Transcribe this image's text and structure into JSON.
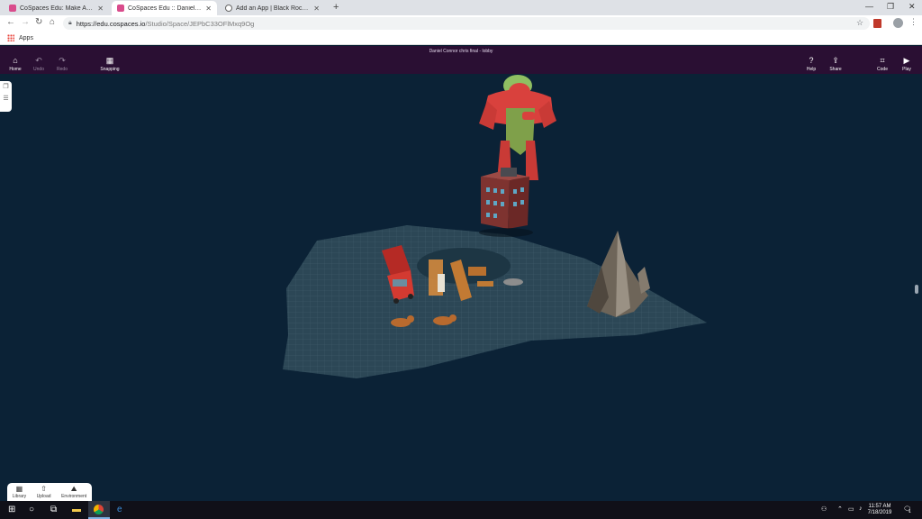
{
  "browser": {
    "tabs": [
      {
        "title": "CoSpaces Edu: Make AR & VR in",
        "favicon": "cospaces-icon",
        "active": false
      },
      {
        "title": "CoSpaces Edu :: Daniel Connor c",
        "favicon": "cospaces-icon",
        "active": true
      },
      {
        "title": "Add an App | Black Rocket Arcad",
        "favicon": "globe-icon",
        "active": false
      }
    ],
    "new_tab": "+",
    "url_host": "https://edu.cospaces.io",
    "url_path": "/Studio/Space/JEPbC33OFlMxq9Og",
    "bookmarks_apps": "Apps"
  },
  "toolbar": {
    "scene_title": "Daniel Connor chris final - lobby",
    "home": "Home",
    "undo": "Undo",
    "redo": "Redo",
    "snapping": "Snapping",
    "help": "Help",
    "share": "Share",
    "code": "Code",
    "play": "Play"
  },
  "library_panel": {
    "library": "Library",
    "upload": "Upload",
    "environment": "Environment"
  },
  "taskbar": {
    "time": "11:57 AM",
    "date": "7/18/2019",
    "notifications": "1"
  },
  "colors": {
    "app_toolbar": "#2a0f33",
    "scene_bg": "#0b2236",
    "taskbar": "#101018"
  }
}
